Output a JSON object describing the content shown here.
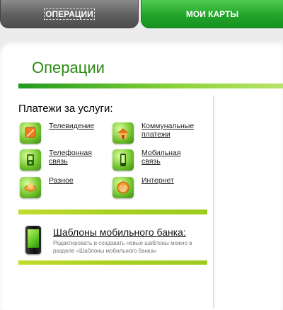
{
  "tabs": {
    "operations": "ОПЕРАЦИИ",
    "my_cards": "МОИ КАРТЫ"
  },
  "page": {
    "title": "Операции",
    "section_title": "Платежи за услуги:"
  },
  "services": [
    {
      "label": "Телевидение",
      "icon": "tv-icon"
    },
    {
      "label": "Коммунальные платежи",
      "icon": "house-icon"
    },
    {
      "label": "Телефонная связь",
      "icon": "phone-icon"
    },
    {
      "label": "Мобильная связь",
      "icon": "mobile-icon"
    },
    {
      "label": "Разное",
      "icon": "misc-icon"
    },
    {
      "label": "Интернет",
      "icon": "internet-icon"
    }
  ],
  "templates": {
    "title": "Шаблоны мобильного банка:",
    "description": "Редактировать и создавать новые шаблоны можно в разделе «Шаблоны мобильного банка»"
  },
  "colors": {
    "accent_green": "#2a8a12",
    "tab_active": "#22a52a",
    "tab_inactive": "#5f5f5f"
  }
}
